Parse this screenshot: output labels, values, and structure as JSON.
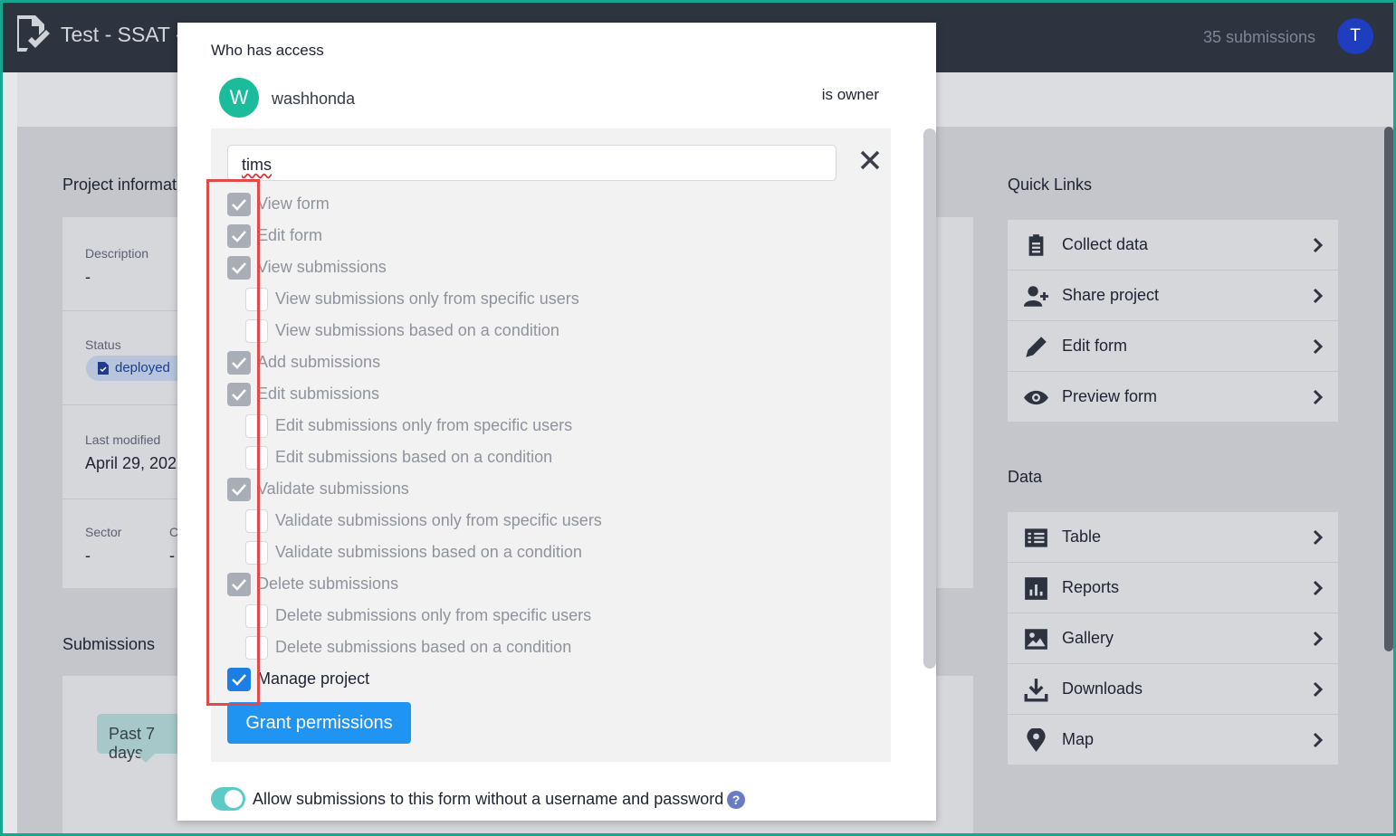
{
  "header": {
    "project_title": "Test - SSAT -",
    "submission_count": "35 submissions",
    "user_initial": "T"
  },
  "background_page": {
    "project_info_title": "Project informat",
    "description_label": "Description",
    "description_value": "-",
    "status_label": "Status",
    "status_value": "deployed",
    "last_modified_label": "Last modified",
    "last_modified_value": "April 29, 202",
    "sector_label": "Sector",
    "sector_value": "-",
    "country_label": "C",
    "country_value": "-",
    "submissions_title": "Submissions",
    "period_label": "Past 7 days",
    "quick_links_title": "Quick Links",
    "quick_links": [
      {
        "label": "Collect data",
        "icon": "clipboard-icon"
      },
      {
        "label": "Share project",
        "icon": "user-plus-icon"
      },
      {
        "label": "Edit form",
        "icon": "pencil-icon"
      },
      {
        "label": "Preview form",
        "icon": "eye-icon"
      }
    ],
    "data_title": "Data",
    "data_links": [
      {
        "label": "Table",
        "icon": "table-icon"
      },
      {
        "label": "Reports",
        "icon": "bar-chart-icon"
      },
      {
        "label": "Gallery",
        "icon": "image-icon"
      },
      {
        "label": "Downloads",
        "icon": "download-icon"
      },
      {
        "label": "Map",
        "icon": "map-pin-icon"
      }
    ]
  },
  "modal": {
    "title": "Who has access",
    "owner": {
      "initial": "W",
      "username": "washhonda",
      "role": "is owner"
    },
    "username_input_value": "tims",
    "permissions": [
      {
        "label": "View form",
        "checked": true,
        "sub": false
      },
      {
        "label": "Edit form",
        "checked": true,
        "sub": false
      },
      {
        "label": "View submissions",
        "checked": true,
        "sub": false
      },
      {
        "label": "View submissions only from specific users",
        "checked": false,
        "sub": true
      },
      {
        "label": "View submissions based on a condition",
        "checked": false,
        "sub": true
      },
      {
        "label": "Add submissions",
        "checked": true,
        "sub": false
      },
      {
        "label": "Edit submissions",
        "checked": true,
        "sub": false
      },
      {
        "label": "Edit submissions only from specific users",
        "checked": false,
        "sub": true
      },
      {
        "label": "Edit submissions based on a condition",
        "checked": false,
        "sub": true
      },
      {
        "label": "Validate submissions",
        "checked": true,
        "sub": false
      },
      {
        "label": "Validate submissions only from specific users",
        "checked": false,
        "sub": true
      },
      {
        "label": "Validate submissions based on a condition",
        "checked": false,
        "sub": true
      },
      {
        "label": "Delete submissions",
        "checked": true,
        "sub": false
      },
      {
        "label": "Delete submissions only from specific users",
        "checked": false,
        "sub": true
      },
      {
        "label": "Delete submissions based on a condition",
        "checked": false,
        "sub": true
      },
      {
        "label": "Manage project",
        "checked": true,
        "sub": false,
        "active": true
      }
    ],
    "grant_button": "Grant permissions",
    "anonymous_toggle_label": "Allow submissions to this form without a username and password",
    "anonymous_toggle_on": true,
    "help_glyph": "?"
  },
  "colors": {
    "accent": "#2094f3",
    "checkbox_disabled": "#a9adb6",
    "checkbox_active": "#1b7fe5",
    "owner_avatar": "#1bbc9b",
    "highlight": "#e24a4a",
    "frame": "#17a68e"
  }
}
